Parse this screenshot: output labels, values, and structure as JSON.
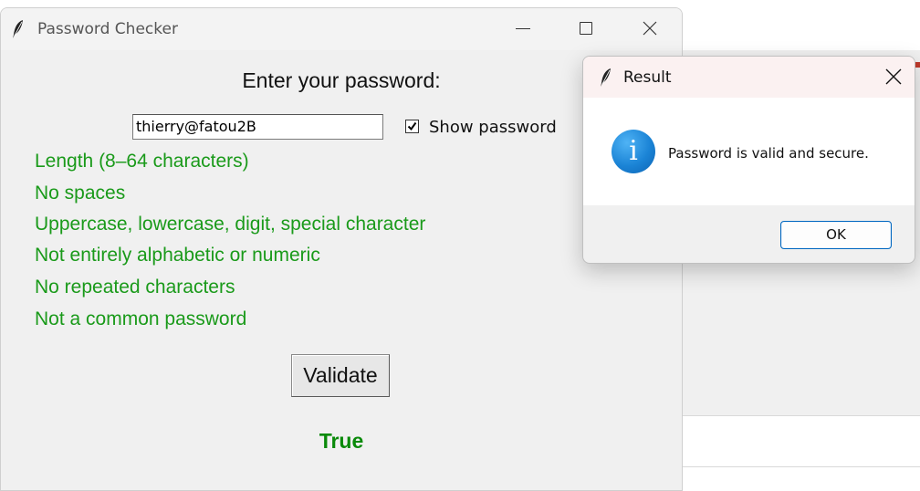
{
  "main_window": {
    "title": "Password Checker",
    "heading": "Enter your password:",
    "password_value": "thierry@fatou2B",
    "show_password_label": "Show password",
    "show_password_checked": true,
    "rules": [
      "Length (8–64 characters)",
      "No spaces",
      "Uppercase, lowercase, digit, special character",
      "Not entirely alphabetic or numeric",
      "No repeated characters",
      "Not a common password"
    ],
    "validate_label": "Validate",
    "result": "True"
  },
  "dialog": {
    "title": "Result",
    "icon": "info-icon",
    "message": "Password is valid and secure.",
    "ok_label": "OK"
  },
  "colors": {
    "rule_text": "#1a9a1a",
    "result_text": "#0a8a0a",
    "info_icon": "#1b84d6",
    "ok_border": "#0067c0"
  }
}
